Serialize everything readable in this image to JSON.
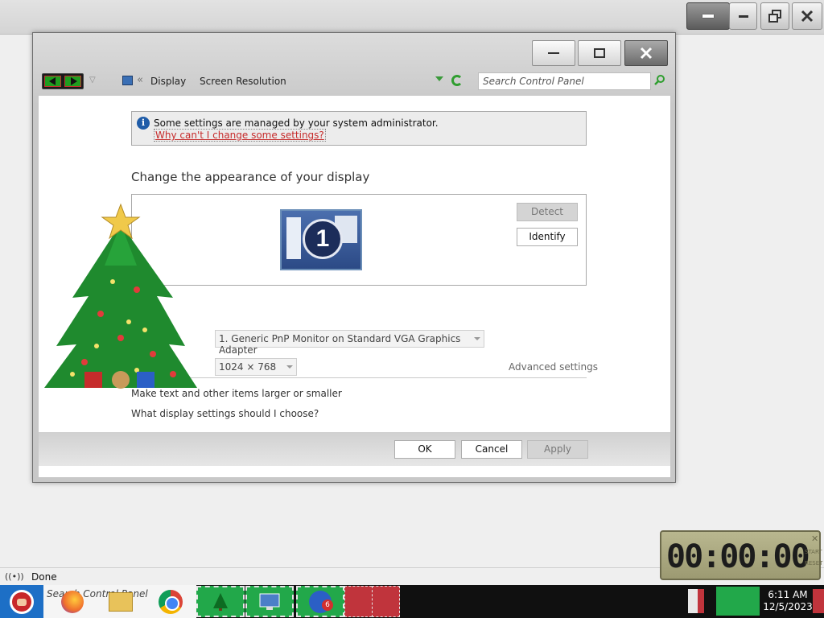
{
  "window": {
    "breadcrumb": {
      "separator": "«",
      "display": "Display",
      "current": "Screen Resolution"
    },
    "search": {
      "placeholder": "Search Control Panel"
    },
    "notice": {
      "text": "Some settings are managed by your system administrator.",
      "link": "Why can't I change some settings?"
    },
    "heading": "Change the appearance of your display",
    "monitor_number": "1",
    "buttons": {
      "detect": "Detect",
      "identify": "Identify"
    },
    "display_select": {
      "value": "1. Generic PnP Monitor on Standard VGA Graphics Adapter"
    },
    "resolution_select": {
      "value": "1024 × 768"
    },
    "advanced_link": "Advanced settings",
    "link_text_size": "Make text and other items larger or smaller",
    "link_choose": "What display settings should I choose?",
    "footer": {
      "ok": "OK",
      "cancel": "Cancel",
      "apply": "Apply"
    }
  },
  "statusbar": {
    "text": "Done"
  },
  "clock_widget": {
    "time": "00:00:00",
    "side_top": "START",
    "side_bottom": "RESET"
  },
  "taskbar": {
    "search_text": "Search Control Panel",
    "badge_count": "6",
    "time": "6:11 AM",
    "date": "12/5/2023"
  },
  "colors": {
    "window_bg": "#c8c8c8",
    "link_red": "#c62b2b",
    "taskbar": "#101010",
    "start_blue": "#1d6fc6",
    "task_green": "#22a84a",
    "task_red": "#c0343c"
  },
  "icons": [
    "minimize-icon",
    "restore-icon",
    "maximize-icon",
    "close-icon",
    "back-arrow-icon",
    "forward-arrow-icon",
    "refresh-icon",
    "search-icon",
    "info-icon",
    "monitor-icon",
    "signal-icon",
    "firefox-icon",
    "folder-icon",
    "chrome-icon",
    "christmas-tree-icon"
  ]
}
